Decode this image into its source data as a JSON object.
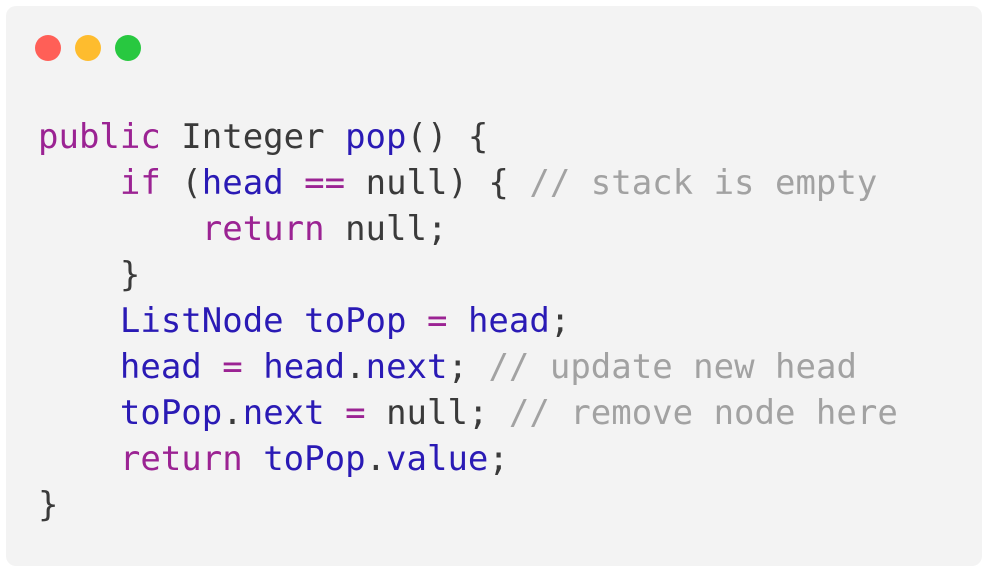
{
  "window": {
    "traffic_lights": [
      {
        "name": "close",
        "color": "#ff5f57"
      },
      {
        "name": "minimize",
        "color": "#febc2e"
      },
      {
        "name": "zoom",
        "color": "#28c840"
      }
    ]
  },
  "colors": {
    "keyword": "#9b2393",
    "identifier": "#2a1ab5",
    "comment": "#a2a2a2",
    "plain": "#3a3a3a"
  },
  "code": {
    "lines": [
      [
        [
          "kw",
          "public"
        ],
        [
          "pl",
          " Integer "
        ],
        [
          "id",
          "pop"
        ],
        [
          "pl",
          "() {"
        ]
      ],
      [
        [
          "pl",
          "    "
        ],
        [
          "kw",
          "if"
        ],
        [
          "pl",
          " ("
        ],
        [
          "id",
          "head"
        ],
        [
          "pl",
          " "
        ],
        [
          "op",
          "=="
        ],
        [
          "pl",
          " null) { "
        ],
        [
          "cm",
          "// stack is empty"
        ]
      ],
      [
        [
          "pl",
          "        "
        ],
        [
          "kw",
          "return"
        ],
        [
          "pl",
          " null;"
        ]
      ],
      [
        [
          "pl",
          "    }"
        ]
      ],
      [
        [
          "pl",
          "    "
        ],
        [
          "id",
          "ListNode"
        ],
        [
          "pl",
          " "
        ],
        [
          "id",
          "toPop"
        ],
        [
          "pl",
          " "
        ],
        [
          "op",
          "="
        ],
        [
          "pl",
          " "
        ],
        [
          "id",
          "head"
        ],
        [
          "pl",
          ";"
        ]
      ],
      [
        [
          "pl",
          "    "
        ],
        [
          "id",
          "head"
        ],
        [
          "pl",
          " "
        ],
        [
          "op",
          "="
        ],
        [
          "pl",
          " "
        ],
        [
          "id",
          "head"
        ],
        [
          "pl",
          "."
        ],
        [
          "id",
          "next"
        ],
        [
          "pl",
          "; "
        ],
        [
          "cm",
          "// update new head"
        ]
      ],
      [
        [
          "pl",
          "    "
        ],
        [
          "id",
          "toPop"
        ],
        [
          "pl",
          "."
        ],
        [
          "id",
          "next"
        ],
        [
          "pl",
          " "
        ],
        [
          "op",
          "="
        ],
        [
          "pl",
          " null; "
        ],
        [
          "cm",
          "// remove node here"
        ]
      ],
      [
        [
          "pl",
          "    "
        ],
        [
          "kw",
          "return"
        ],
        [
          "pl",
          " "
        ],
        [
          "id",
          "toPop"
        ],
        [
          "pl",
          "."
        ],
        [
          "id",
          "value"
        ],
        [
          "pl",
          ";"
        ]
      ],
      [
        [
          "pl",
          "}"
        ]
      ]
    ]
  }
}
